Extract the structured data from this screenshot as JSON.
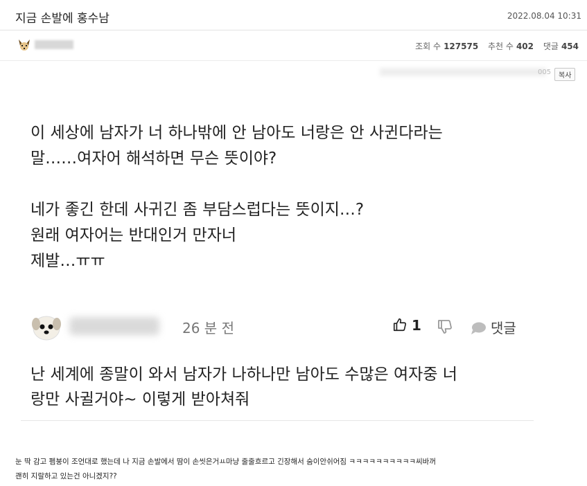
{
  "post": {
    "title": "지금 손발에 홍수남",
    "date": "2022.08.04 10:31"
  },
  "meta": {
    "views_label": "조회 수",
    "views": "127575",
    "likes_label": "추천 수",
    "likes": "402",
    "comments_label": "댓글",
    "comments": "454"
  },
  "screenshot": {
    "url_suffix": "005",
    "copy_label": "복사",
    "question": "이 세상에 남자가 너 하나밖에 안 남아도 너랑은 안 사귄다라는\n말……여자어 해석하면 무슨 뜻이야?\n\n네가 좋긴 한데 사귀긴 좀 부담스럽다는 뜻이지…?\n원래 여자어는 반대인거 만자너\n제발…ㅠㅠ",
    "comment": {
      "time": "26 분 전",
      "like_count": "1",
      "reply_label": "댓글",
      "text": "난 세계에 종말이 와서 남자가 나하나만 남아도 수많은 여자중 너\n랑만 사귈거야~ 이렇게 받아쳐줘"
    }
  },
  "caption": "눈 딱 감고 펨붕이 조언대로 했는데 나 지금 손발에서 땀이 손씻은거ㅛ마냥 줄줄흐르고 긴장해서 숨이안쉬어짐 ㅋㅋㅋㅋㅋㅋㅋㅋㅋㅋ씨바꺼\n괜히 지랄하고 있는건 아니겠지??",
  "colors": {
    "text": "#222222",
    "muted": "#777777",
    "border": "#e3e3e3"
  },
  "icons": [
    "puppy-avatar-icon",
    "thumbs-up-icon",
    "thumbs-down-icon",
    "speech-bubble-icon"
  ]
}
